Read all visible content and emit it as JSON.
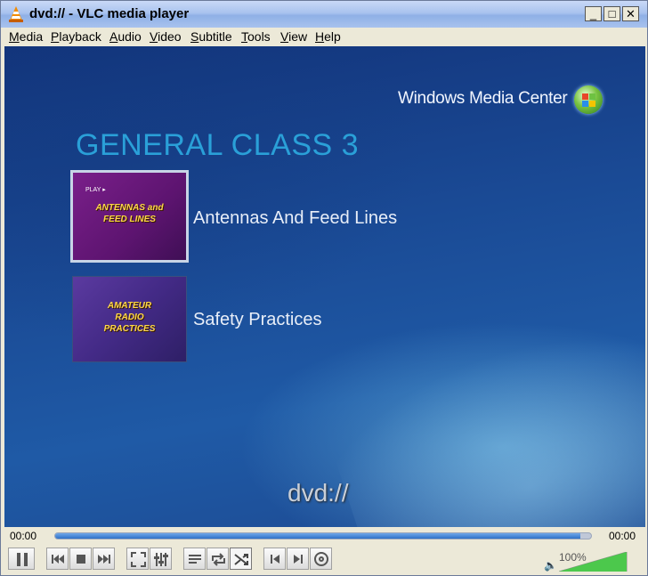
{
  "window": {
    "title": "dvd:// - VLC media player"
  },
  "menu": [
    "Media",
    "Playback",
    "Audio",
    "Video",
    "Subtitle",
    "Tools",
    "View",
    "Help"
  ],
  "video": {
    "logo_text": "Windows Media Center",
    "heading": "GENERAL CLASS 3",
    "options": [
      {
        "label": "Antennas And Feed Lines",
        "thumb_text": "ANTENNAS and FEED LINES",
        "thumb_tag": "PLAY ▸"
      },
      {
        "label": "Safety Practices",
        "thumb_text": "AMATEUR RADIO PRACTICES"
      }
    ],
    "osd_text": "dvd://"
  },
  "seek": {
    "elapsed": "00:00",
    "remaining": "00:00",
    "progress": 0.98
  },
  "volume": {
    "level_text": "100%",
    "level": 1.0
  },
  "colors": {
    "heading": "#2aa0d8",
    "accent": "#2f71c7",
    "volume_fill": "#4cc84c"
  },
  "icons": [
    "vlc-cone-icon",
    "pause-icon",
    "previous-icon",
    "stop-icon",
    "next-icon",
    "fullscreen-icon",
    "extended-settings-icon",
    "playlist-icon",
    "loop-icon",
    "shuffle-icon",
    "frame-prev-icon",
    "frame-next-icon",
    "dvd-menu-icon",
    "speaker-icon"
  ]
}
